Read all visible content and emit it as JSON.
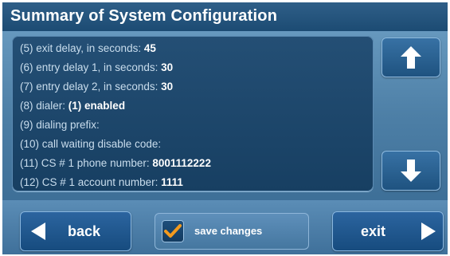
{
  "header": {
    "title": "Summary of System Configuration"
  },
  "summary": {
    "items": [
      {
        "label": "(5) exit delay, in seconds:",
        "value": "45"
      },
      {
        "label": "(6) entry delay 1, in seconds:",
        "value": "30"
      },
      {
        "label": "(7) entry delay 2, in seconds:",
        "value": "30"
      },
      {
        "label": "(8) dialer:",
        "value": "(1) enabled"
      },
      {
        "label": "(9) dialing prefix:",
        "value": ""
      },
      {
        "label": "(10) call waiting disable code:",
        "value": ""
      },
      {
        "label": "(11) CS # 1 phone number:",
        "value": "8001112222"
      },
      {
        "label": "(12) CS # 1 account number:",
        "value": "1111"
      }
    ]
  },
  "scroll": {
    "up_icon": "arrow-up-icon",
    "down_icon": "arrow-down-icon"
  },
  "footer": {
    "back_label": "back",
    "back_icon": "triangle-left-icon",
    "save_label": "save changes",
    "save_checked": true,
    "exit_label": "exit",
    "exit_icon": "triangle-right-icon"
  },
  "colors": {
    "checkmark": "#f39a1e",
    "panel": "#1d4669",
    "accent_button": "#235a8e"
  }
}
